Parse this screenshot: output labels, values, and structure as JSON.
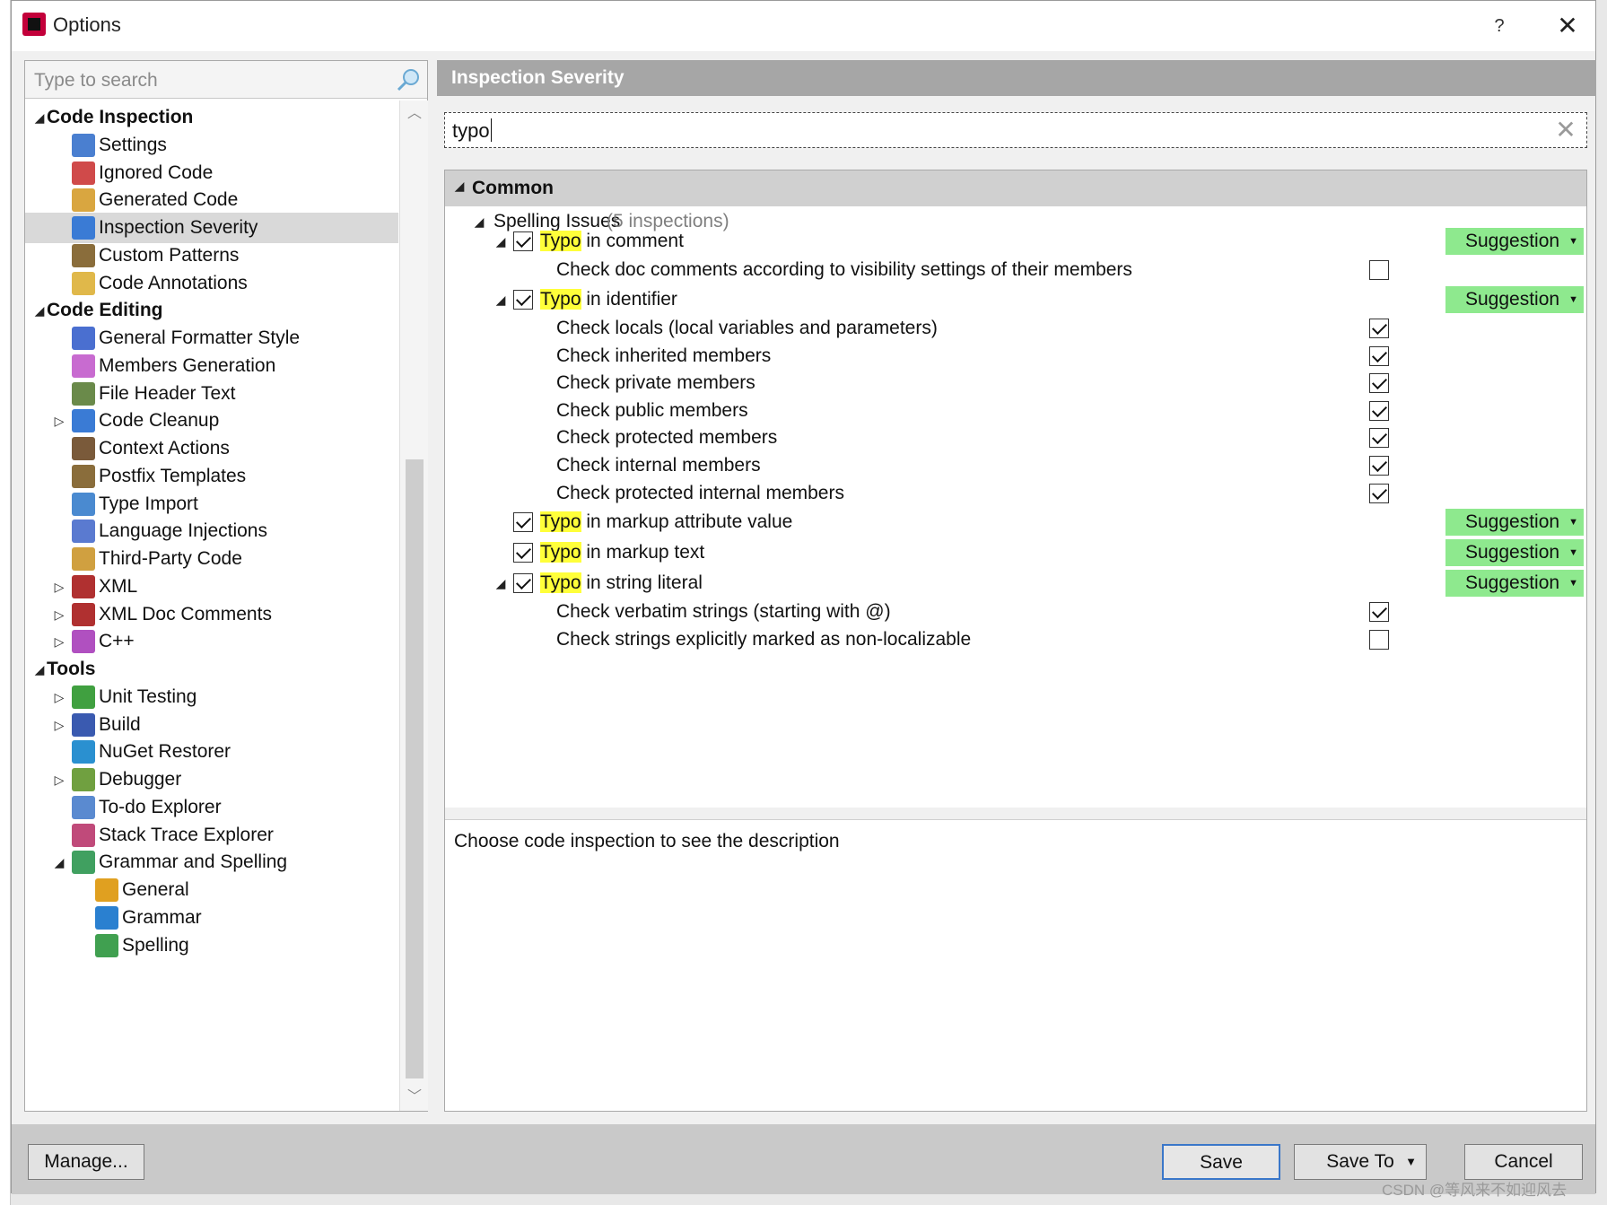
{
  "window": {
    "title": "Options",
    "help": "?",
    "close": "✕"
  },
  "nav": {
    "search_placeholder": "Type to search",
    "items": [
      {
        "label": "Code Inspection",
        "icon": "section",
        "expander": "expanded",
        "level": 0,
        "section": true
      },
      {
        "label": "Settings",
        "icon": "settings-icon",
        "level": 1
      },
      {
        "label": "Ignored Code",
        "icon": "ignored-code-icon",
        "level": 1
      },
      {
        "label": "Generated Code",
        "icon": "generated-code-icon",
        "level": 1
      },
      {
        "label": "Inspection Severity",
        "icon": "inspection-severity-icon",
        "level": 1,
        "selected": true
      },
      {
        "label": "Custom Patterns",
        "icon": "custom-patterns-icon",
        "level": 1
      },
      {
        "label": "Code Annotations",
        "icon": "code-annotations-icon",
        "level": 1
      },
      {
        "label": "Code Editing",
        "icon": "section",
        "expander": "expanded",
        "level": 0,
        "section": true
      },
      {
        "label": "General Formatter Style",
        "icon": "formatter-icon",
        "level": 1
      },
      {
        "label": "Members Generation",
        "icon": "members-generation-icon",
        "level": 1
      },
      {
        "label": "File Header Text",
        "icon": "file-header-icon",
        "level": 1
      },
      {
        "label": "Code Cleanup",
        "icon": "broom-icon",
        "expander": "collapsed",
        "level": 1
      },
      {
        "label": "Context Actions",
        "icon": "hammer-icon",
        "level": 1
      },
      {
        "label": "Postfix Templates",
        "icon": "postfix-templates-icon",
        "level": 1
      },
      {
        "label": "Type Import",
        "icon": "type-import-icon",
        "level": 1
      },
      {
        "label": "Language Injections",
        "icon": "syringe-icon",
        "level": 1
      },
      {
        "label": "Third-Party Code",
        "icon": "books-icon",
        "level": 1
      },
      {
        "label": "XML",
        "icon": "xml-icon",
        "expander": "collapsed",
        "level": 1
      },
      {
        "label": "XML Doc Comments",
        "icon": "xml-doc-icon",
        "expander": "collapsed",
        "level": 1
      },
      {
        "label": "C++",
        "icon": "cpp-icon",
        "expander": "collapsed",
        "level": 1
      },
      {
        "label": "Tools",
        "icon": "section",
        "expander": "expanded",
        "level": 0,
        "section": true
      },
      {
        "label": "Unit Testing",
        "icon": "unit-testing-icon",
        "expander": "collapsed",
        "level": 1
      },
      {
        "label": "Build",
        "icon": "build-icon",
        "expander": "collapsed",
        "level": 1
      },
      {
        "label": "NuGet Restorer",
        "icon": "nuget-icon",
        "level": 1
      },
      {
        "label": "Debugger",
        "icon": "bug-icon",
        "expander": "collapsed",
        "level": 1
      },
      {
        "label": "To-do Explorer",
        "icon": "todo-icon",
        "level": 1
      },
      {
        "label": "Stack Trace Explorer",
        "icon": "stack-trace-icon",
        "level": 1
      },
      {
        "label": "Grammar and Spelling",
        "icon": "grammar-spelling-icon",
        "expander": "expanded",
        "level": 1
      },
      {
        "label": "General",
        "icon": "gear-icon",
        "level": 2
      },
      {
        "label": "Grammar",
        "icon": "grammar-icon",
        "level": 2
      },
      {
        "label": "Spelling",
        "icon": "spelling-icon",
        "level": 2
      }
    ]
  },
  "right": {
    "title": "Inspection Severity",
    "filter_value": "typo",
    "clear_glyph": "✕",
    "group_label": "Common",
    "subgroup_label": "Spelling Issues",
    "subgroup_count": "(5 inspections)",
    "rows": [
      {
        "kind": "inspection",
        "hl": "Typo",
        "rest": " in comment",
        "checked": true,
        "expander": true,
        "severity": "Suggestion"
      },
      {
        "kind": "option",
        "label": "Check doc comments according to visibility settings of their members",
        "checked": false
      },
      {
        "kind": "inspection",
        "hl": "Typo",
        "rest": " in identifier",
        "checked": true,
        "expander": true,
        "severity": "Suggestion"
      },
      {
        "kind": "option",
        "label": "Check locals (local variables and parameters)",
        "checked": true
      },
      {
        "kind": "option",
        "label": "Check inherited members",
        "checked": true
      },
      {
        "kind": "option",
        "label": "Check private members",
        "checked": true
      },
      {
        "kind": "option",
        "label": "Check public members",
        "checked": true
      },
      {
        "kind": "option",
        "label": "Check protected members",
        "checked": true
      },
      {
        "kind": "option",
        "label": "Check internal members",
        "checked": true
      },
      {
        "kind": "option",
        "label": "Check protected internal members",
        "checked": true
      },
      {
        "kind": "inspection",
        "hl": "Typo",
        "rest": " in markup attribute value",
        "checked": true,
        "expander": false,
        "severity": "Suggestion"
      },
      {
        "kind": "inspection",
        "hl": "Typo",
        "rest": " in markup text",
        "checked": true,
        "expander": false,
        "severity": "Suggestion"
      },
      {
        "kind": "inspection",
        "hl": "Typo",
        "rest": " in string literal",
        "checked": true,
        "expander": true,
        "severity": "Suggestion"
      },
      {
        "kind": "option",
        "label": "Check verbatim strings (starting with @)",
        "checked": true
      },
      {
        "kind": "option",
        "label": "Check strings explicitly marked as non-localizable",
        "checked": false
      }
    ],
    "description": "Choose code inspection to see the description"
  },
  "footer": {
    "manage_label": "Manage...",
    "save_label": "Save",
    "save_to_label": "Save To",
    "cancel_label": "Cancel"
  },
  "watermark": "CSDN @等风来不如迎风去",
  "colors": {
    "severity_suggestion": "#8ee98e",
    "search_highlight": "#ffff3a",
    "selected_row": "#d9d9d9",
    "header_bar": "#a6a6a6"
  }
}
